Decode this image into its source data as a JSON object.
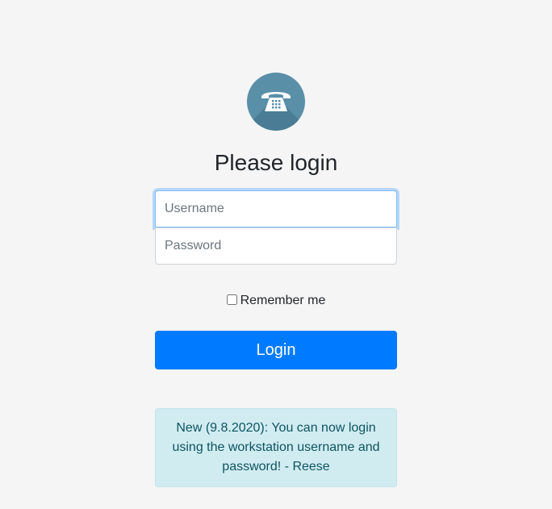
{
  "header": {
    "logo_icon": "telephone-icon",
    "title": "Please login"
  },
  "form": {
    "username_placeholder": "Username",
    "password_placeholder": "Password",
    "remember_label": "Remember me",
    "login_label": "Login"
  },
  "notice": {
    "text": "New (9.8.2020): You can now login using the workstation username and password! - Reese"
  },
  "colors": {
    "logo_bg": "#5a8fa8",
    "primary": "#007bff",
    "alert_bg": "#d1ecf1",
    "alert_text": "#0c5460"
  }
}
